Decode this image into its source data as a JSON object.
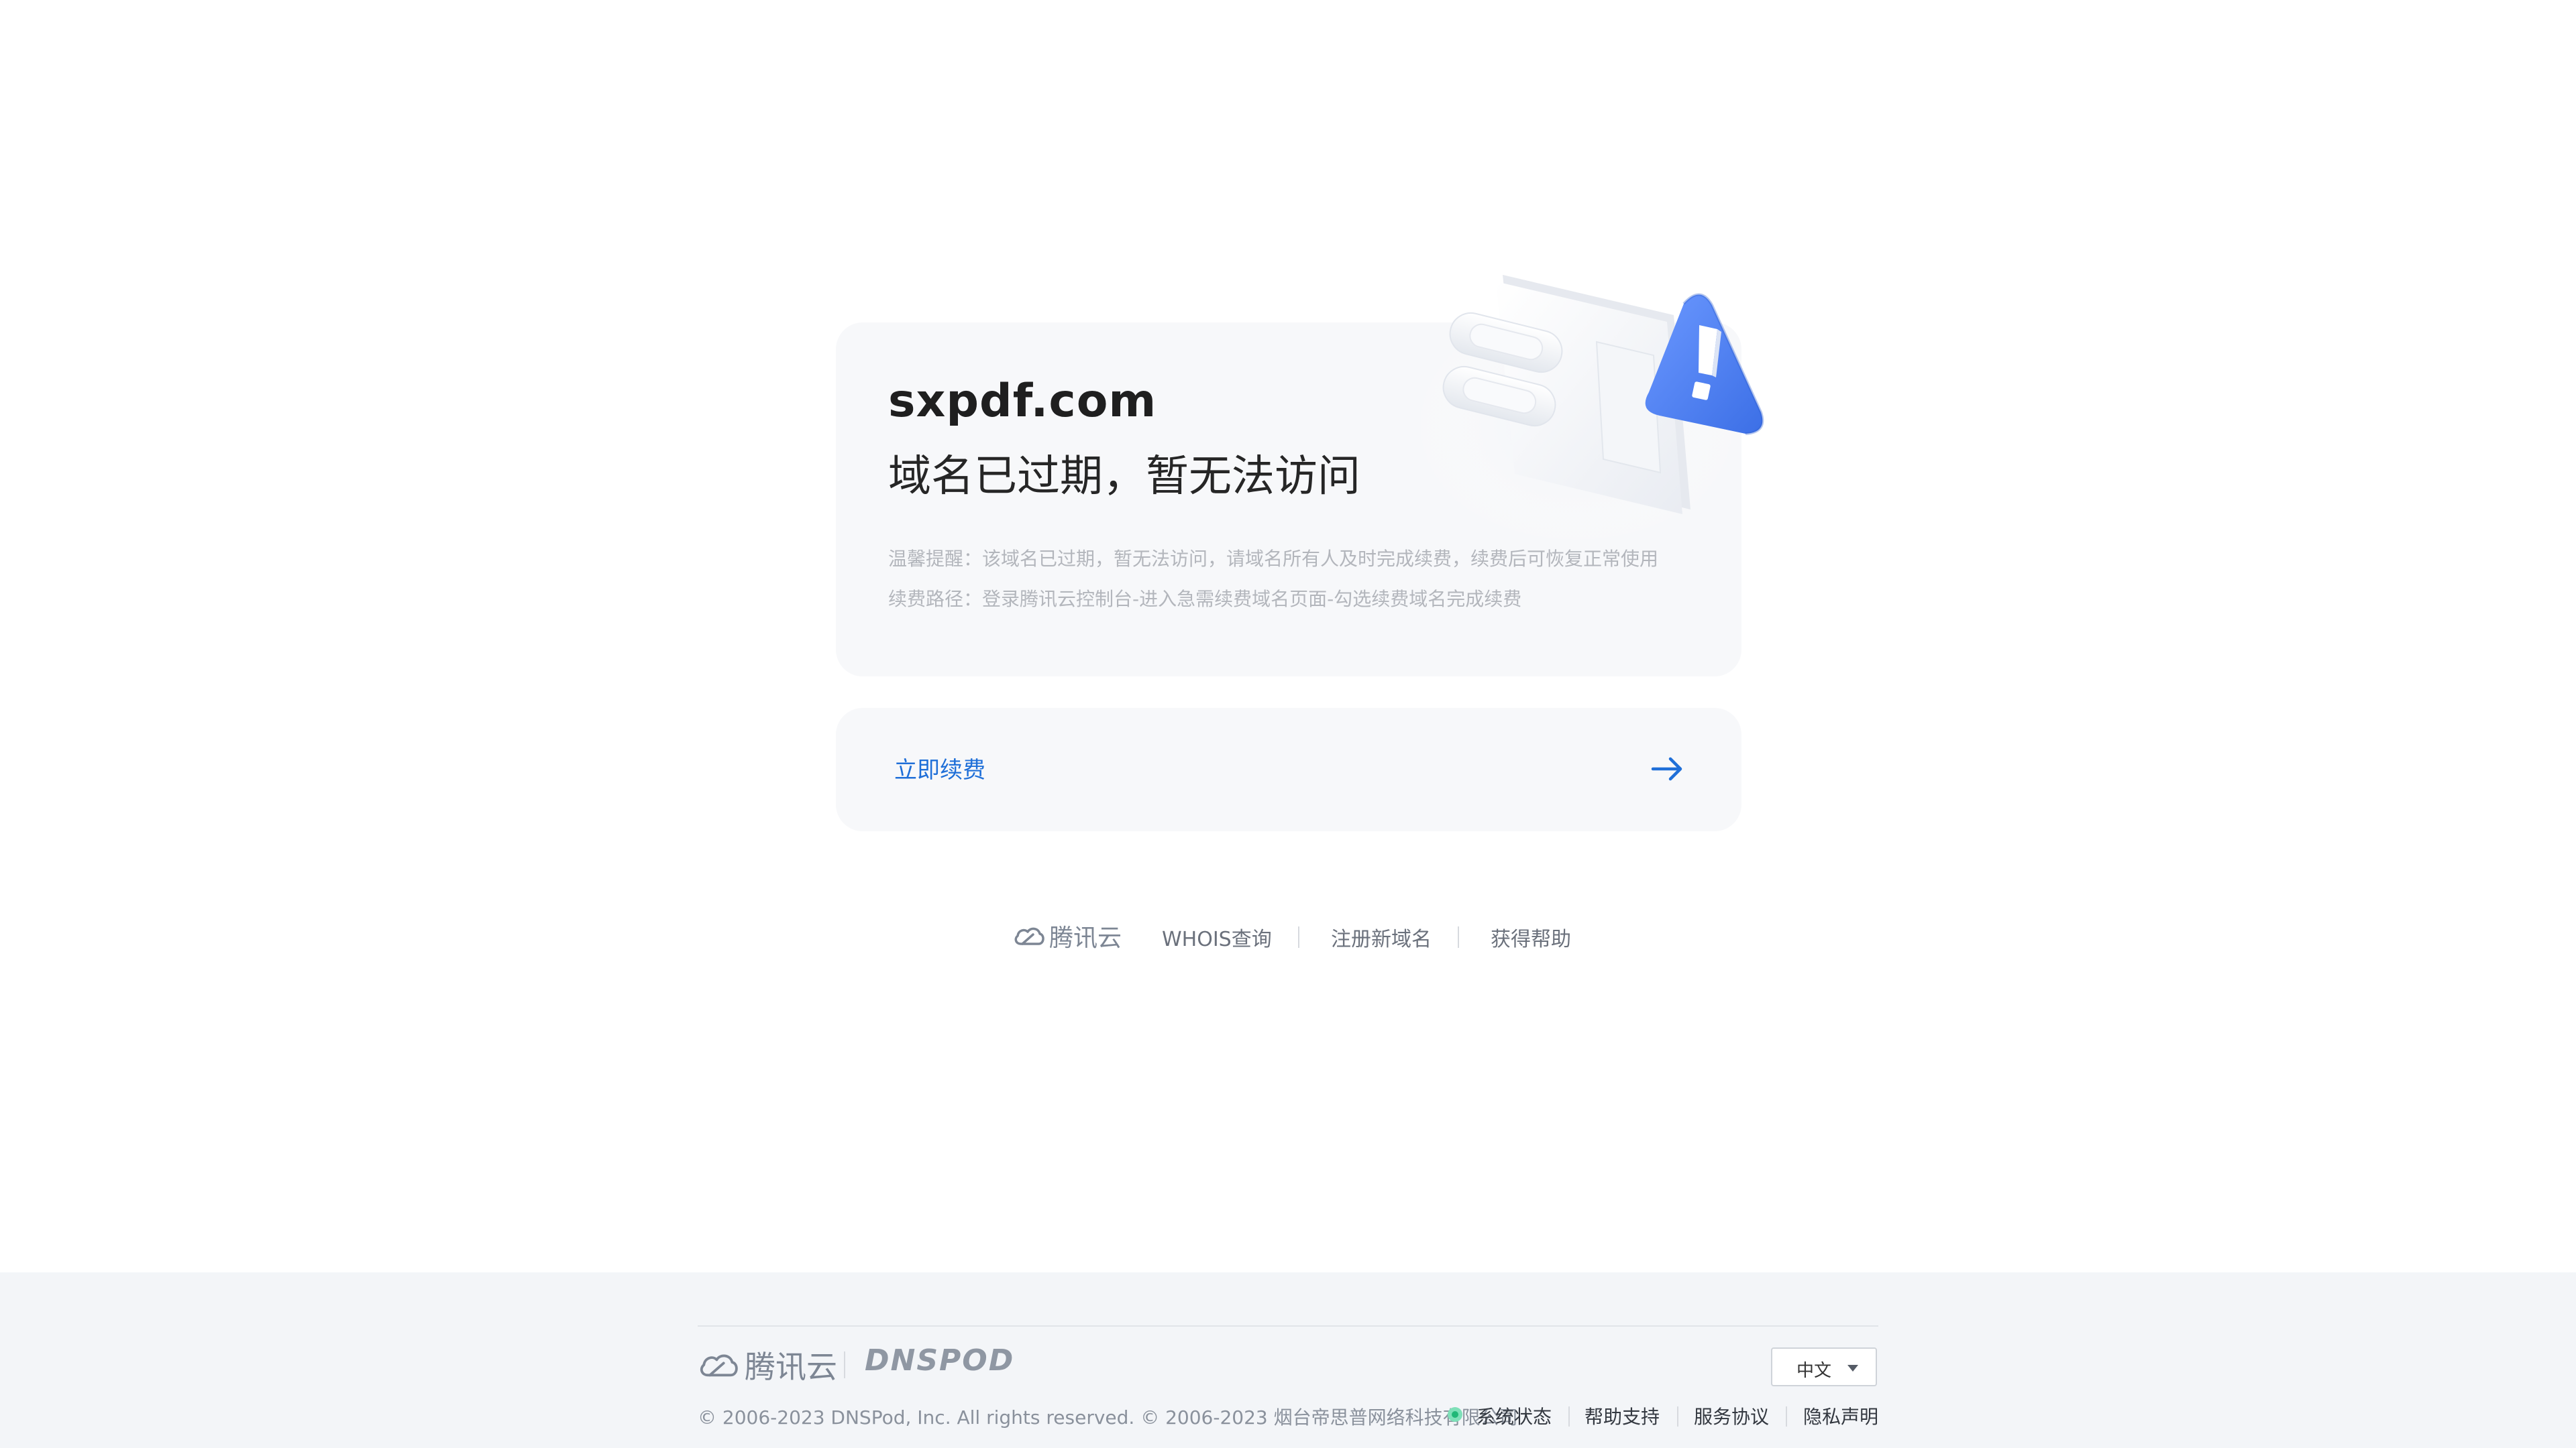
{
  "domain": "sxpdf.com",
  "status_title": "域名已过期，暂无法访问",
  "tips": [
    "温馨提醒：该域名已过期，暂无法访问，请域名所有人及时完成续费，续费后可恢复正常使用",
    "续费路径：登录腾讯云控制台-进入急需续费域名页面-勾选续费域名完成续费"
  ],
  "renew": {
    "label": "立即续费",
    "icon": "arrow-right-icon"
  },
  "sublinks": {
    "brand": "腾讯云",
    "items": [
      "WHOIS查询",
      "注册新域名",
      "获得帮助"
    ]
  },
  "footer": {
    "brand_tencent": "腾讯云",
    "brand_dnspod": "DNSPOD",
    "language": "中文",
    "copyright": "© 2006-2023 DNSPod, Inc. All rights reserved. © 2006-2023 烟台帝思普网络科技有限公司",
    "links": [
      "系统状态",
      "帮助支持",
      "服务协议",
      "隐私声明"
    ]
  },
  "colors": {
    "accent": "#1f6fd8",
    "warning_blue": "#4e7ff0",
    "status_green": "#1fb877",
    "card_bg": "#f7f8fa",
    "footer_bg": "#f3f5f8"
  }
}
